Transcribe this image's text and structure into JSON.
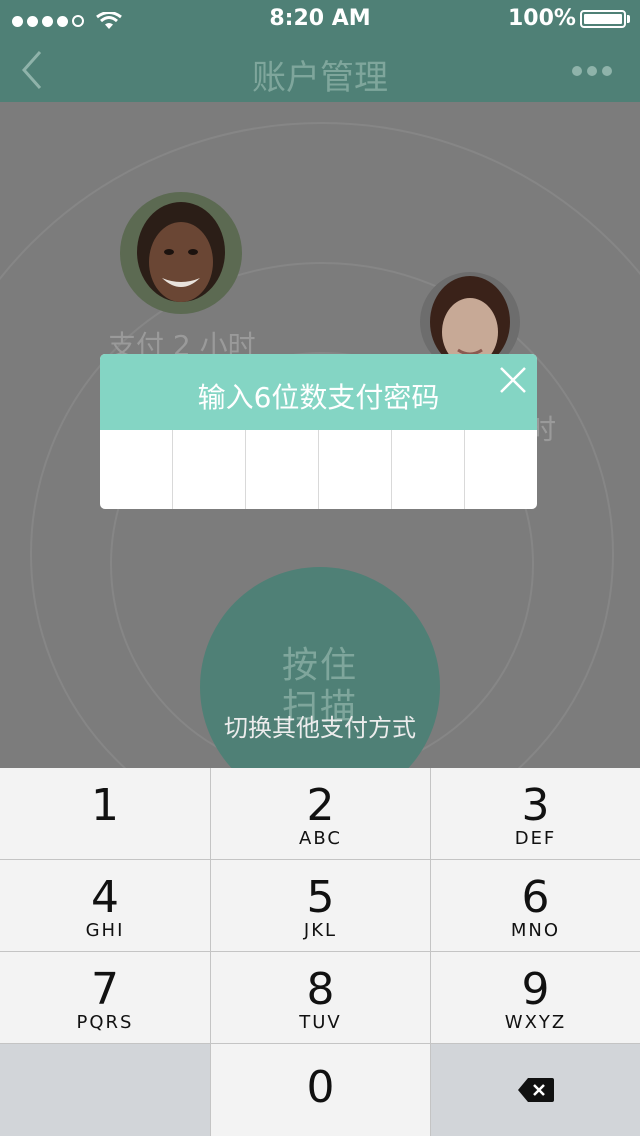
{
  "status_bar": {
    "time": "8:20 AM",
    "battery": "100%",
    "signal": "signal-dots-icon",
    "wifi": "wifi-icon"
  },
  "nav": {
    "title": "账户管理",
    "back_icon": "chevron-left-icon",
    "more_icon": "more-dots-icon"
  },
  "users": [
    {
      "label": "支付 2 小时"
    },
    {
      "label": "时"
    }
  ],
  "scan_button": {
    "line1": "按住",
    "line2": "扫描"
  },
  "switch_link": "切换其他支付方式",
  "modal": {
    "title": "输入6位数支付密码",
    "close_icon": "close-icon",
    "digits": [
      "",
      "",
      "",
      "",
      "",
      ""
    ]
  },
  "keypad": {
    "keys": [
      {
        "num": "1",
        "letters": ""
      },
      {
        "num": "2",
        "letters": "ABC"
      },
      {
        "num": "3",
        "letters": "DEF"
      },
      {
        "num": "4",
        "letters": "GHI"
      },
      {
        "num": "5",
        "letters": "JKL"
      },
      {
        "num": "6",
        "letters": "MNO"
      },
      {
        "num": "7",
        "letters": "PQRS"
      },
      {
        "num": "8",
        "letters": "TUV"
      },
      {
        "num": "9",
        "letters": "WXYZ"
      },
      {
        "num": "0",
        "letters": ""
      }
    ],
    "delete_icon": "backspace-icon"
  },
  "colors": {
    "header": "#4f8076",
    "modal_header": "#84d5c4",
    "overlay": "#7c7c7c"
  }
}
